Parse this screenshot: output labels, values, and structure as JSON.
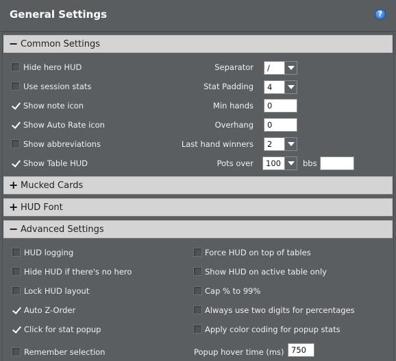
{
  "title": "General Settings",
  "help_icon_text": "?",
  "sections": {
    "common": {
      "sign": "−",
      "label": "Common Settings"
    },
    "mucked": {
      "sign": "+",
      "label": "Mucked Cards"
    },
    "font": {
      "sign": "+",
      "label": "HUD Font"
    },
    "advanced": {
      "sign": "−",
      "label": "Advanced Settings"
    }
  },
  "common": {
    "checkboxes": [
      {
        "label": "Hide hero HUD",
        "checked": false
      },
      {
        "label": "Use session stats",
        "checked": false
      },
      {
        "label": "Show note icon",
        "checked": true
      },
      {
        "label": "Show Auto Rate icon",
        "checked": true
      },
      {
        "label": "Show abbreviations",
        "checked": false
      },
      {
        "label": "Show Table HUD",
        "checked": true
      }
    ],
    "separator": {
      "label": "Separator",
      "value": "/"
    },
    "stat_padding": {
      "label": "Stat Padding",
      "value": "4"
    },
    "min_hands": {
      "label": "Min hands",
      "value": "0"
    },
    "overhang": {
      "label": "Overhang",
      "value": "0"
    },
    "last_hand_winners": {
      "label": "Last hand winners",
      "value": "2"
    },
    "pots_over": {
      "label": "Pots over",
      "value": "100",
      "unit": "bbs",
      "color": "#ffffff"
    }
  },
  "advanced": {
    "left": [
      {
        "label": "HUD logging",
        "checked": false
      },
      {
        "label": "Hide HUD if there's no hero",
        "checked": false
      },
      {
        "label": "Lock HUD layout",
        "checked": false
      },
      {
        "label": "Auto Z-Order",
        "checked": true
      },
      {
        "label": "Click for stat popup",
        "checked": true
      },
      {
        "label": "Remember selection",
        "checked": false
      }
    ],
    "right": [
      {
        "label": "Force HUD on top of tables",
        "checked": false
      },
      {
        "label": "Show HUD on active table only",
        "checked": false
      },
      {
        "label": "Cap % to 99%",
        "checked": false
      },
      {
        "label": "Always use two digits for percentages",
        "checked": false
      },
      {
        "label": "Apply color coding for popup stats",
        "checked": false
      }
    ],
    "popup_hover": {
      "label": "Popup hover time (ms)",
      "value": "750"
    }
  }
}
